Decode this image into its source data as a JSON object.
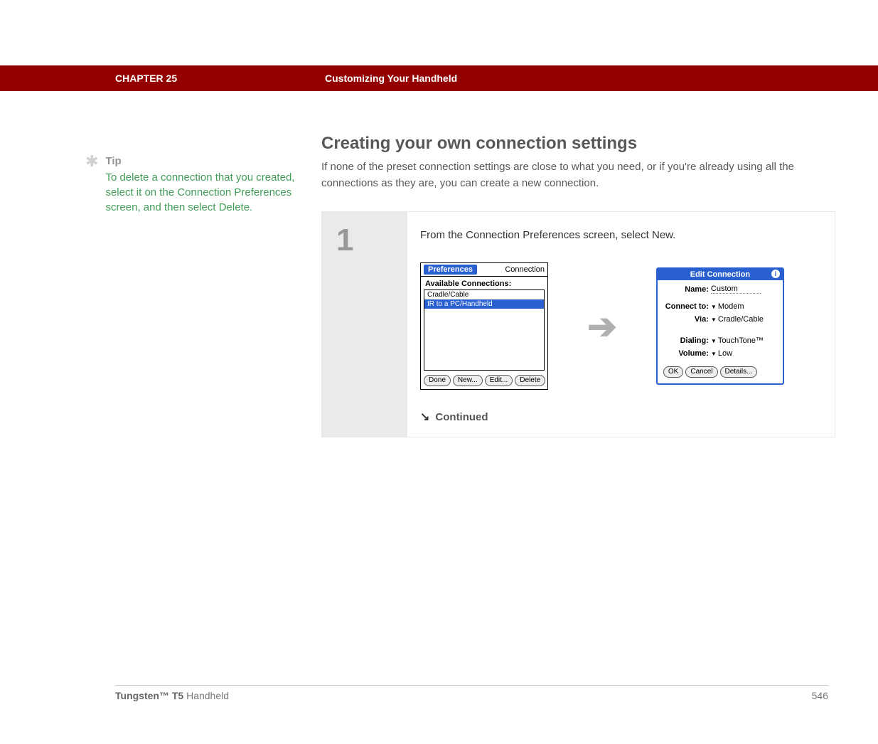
{
  "header": {
    "chapter": "CHAPTER 25",
    "title": "Customizing Your Handheld"
  },
  "tip": {
    "heading": "Tip",
    "text": "To delete a connection that you created, select it on the Connection Preferences screen, and then select Delete."
  },
  "section": {
    "title": "Creating your own connection settings",
    "intro": "If none of the preset connection settings are close to what you need, or if you're already using all the connections as they are, you can create a new connection."
  },
  "step": {
    "number": "1",
    "instruction": "From the Connection Preferences screen, select New.",
    "continued": "Continued"
  },
  "palm_prefs": {
    "tab_label": "Preferences",
    "right_label": "Connection",
    "available_label": "Available Connections:",
    "items": [
      "Cradle/Cable",
      "IR to a PC/Handheld"
    ],
    "buttons": {
      "done": "Done",
      "new": "New...",
      "edit": "Edit...",
      "delete": "Delete"
    }
  },
  "edit_conn": {
    "title": "Edit Connection",
    "name_label": "Name:",
    "name_value": "Custom",
    "connect_label": "Connect to:",
    "connect_value": "Modem",
    "via_label": "Via:",
    "via_value": "Cradle/Cable",
    "dialing_label": "Dialing:",
    "dialing_value": "TouchTone™",
    "volume_label": "Volume:",
    "volume_value": "Low",
    "buttons": {
      "ok": "OK",
      "cancel": "Cancel",
      "details": "Details..."
    }
  },
  "footer": {
    "product_bold": "Tungsten™ T5",
    "product_rest": " Handheld",
    "page": "546"
  }
}
